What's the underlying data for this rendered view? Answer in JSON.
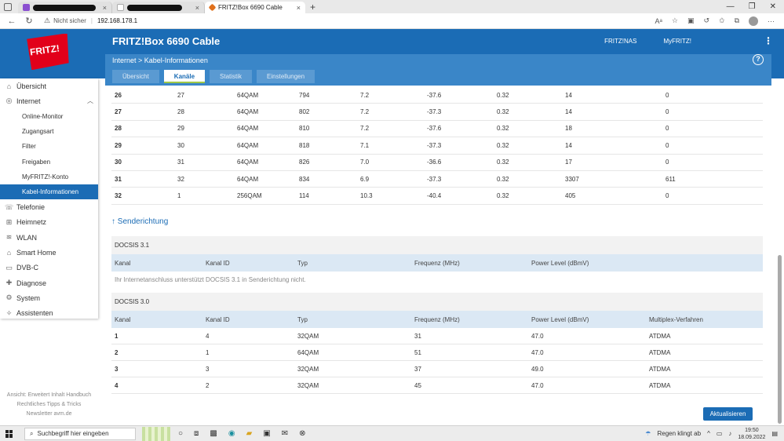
{
  "browser": {
    "tabs": [
      {
        "title": "",
        "active": false
      },
      {
        "title": "",
        "active": false
      },
      {
        "title": "FRITZ!Box 6690 Cable",
        "active": true
      }
    ],
    "new_tab": "+",
    "not_secure": "Nicht sicher",
    "url": "192.168.178.1"
  },
  "header": {
    "logo": "FRITZ!",
    "title": "FRITZ!Box 6690 Cable",
    "links": [
      "FRITZ!NAS",
      "MyFRITZ!"
    ],
    "breadcrumb": "Internet > Kabel-Informationen",
    "tabs": [
      {
        "label": "Übersicht",
        "active": false
      },
      {
        "label": "Kanäle",
        "active": true
      },
      {
        "label": "Statistik",
        "active": false
      },
      {
        "label": "Einstellungen",
        "active": false
      }
    ]
  },
  "sidebar": {
    "items": [
      {
        "label": "Übersicht",
        "icon": "home-icon",
        "sub": false
      },
      {
        "label": "Internet",
        "icon": "globe-icon",
        "sub": false,
        "expanded": true
      },
      {
        "label": "Online-Monitor",
        "sub": true
      },
      {
        "label": "Zugangsart",
        "sub": true
      },
      {
        "label": "Filter",
        "sub": true
      },
      {
        "label": "Freigaben",
        "sub": true
      },
      {
        "label": "MyFRITZ!-Konto",
        "sub": true
      },
      {
        "label": "Kabel-Informationen",
        "sub": true,
        "active": true
      },
      {
        "label": "Telefonie",
        "icon": "phone-icon",
        "sub": false
      },
      {
        "label": "Heimnetz",
        "icon": "network-icon",
        "sub": false
      },
      {
        "label": "WLAN",
        "icon": "wifi-icon",
        "sub": false
      },
      {
        "label": "Smart Home",
        "icon": "smarthome-icon",
        "sub": false
      },
      {
        "label": "DVB-C",
        "icon": "tv-icon",
        "sub": false
      },
      {
        "label": "Diagnose",
        "icon": "diagnose-icon",
        "sub": false
      },
      {
        "label": "System",
        "icon": "system-icon",
        "sub": false
      },
      {
        "label": "Assistenten",
        "icon": "wizard-icon",
        "sub": false
      }
    ],
    "footer": {
      "line1": "Ansicht: Erweitert   Inhalt   Handbuch",
      "line2": "Rechtliches   Tipps & Tricks",
      "line3": "Newsletter   avm.de"
    }
  },
  "downstream_rows": [
    [
      "26",
      "27",
      "64QAM",
      "794",
      "7.2",
      "-37.6",
      "0.32",
      "14",
      "0"
    ],
    [
      "27",
      "28",
      "64QAM",
      "802",
      "7.2",
      "-37.3",
      "0.32",
      "14",
      "0"
    ],
    [
      "28",
      "29",
      "64QAM",
      "810",
      "7.2",
      "-37.6",
      "0.32",
      "18",
      "0"
    ],
    [
      "29",
      "30",
      "64QAM",
      "818",
      "7.1",
      "-37.3",
      "0.32",
      "14",
      "0"
    ],
    [
      "30",
      "31",
      "64QAM",
      "826",
      "7.0",
      "-36.6",
      "0.32",
      "17",
      "0"
    ],
    [
      "31",
      "32",
      "64QAM",
      "834",
      "6.9",
      "-37.3",
      "0.32",
      "3307",
      "611"
    ],
    [
      "32",
      "1",
      "256QAM",
      "114",
      "10.3",
      "-40.4",
      "0.32",
      "405",
      "0"
    ]
  ],
  "upstream": {
    "title": "↑ Senderichtung",
    "docsis31": {
      "label": "DOCSIS 3.1",
      "headers": [
        "Kanal",
        "Kanal ID",
        "Typ",
        "Frequenz (MHz)",
        "Power Level (dBmV)"
      ],
      "note": "Ihr Internetanschluss unterstützt DOCSIS 3.1 in Senderichtung nicht."
    },
    "docsis30": {
      "label": "DOCSIS 3.0",
      "headers": [
        "Kanal",
        "Kanal ID",
        "Typ",
        "Frequenz (MHz)",
        "Power Level (dBmV)",
        "Multiplex-Verfahren"
      ],
      "rows": [
        [
          "1",
          "4",
          "32QAM",
          "31",
          "47.0",
          "ATDMA"
        ],
        [
          "2",
          "1",
          "64QAM",
          "51",
          "47.0",
          "ATDMA"
        ],
        [
          "3",
          "3",
          "32QAM",
          "37",
          "49.0",
          "ATDMA"
        ],
        [
          "4",
          "2",
          "32QAM",
          "45",
          "47.0",
          "ATDMA"
        ]
      ]
    }
  },
  "refresh_button": "Aktualisieren",
  "taskbar": {
    "search_placeholder": "Suchbegriff hier eingeben",
    "weather": "Regen klingt ab",
    "time": "19:50",
    "date": "18.09.2022"
  },
  "colors": {
    "brand_blue": "#1b6cb5",
    "sub_blue": "#3a86c8",
    "table_header": "#dbe8f4"
  }
}
